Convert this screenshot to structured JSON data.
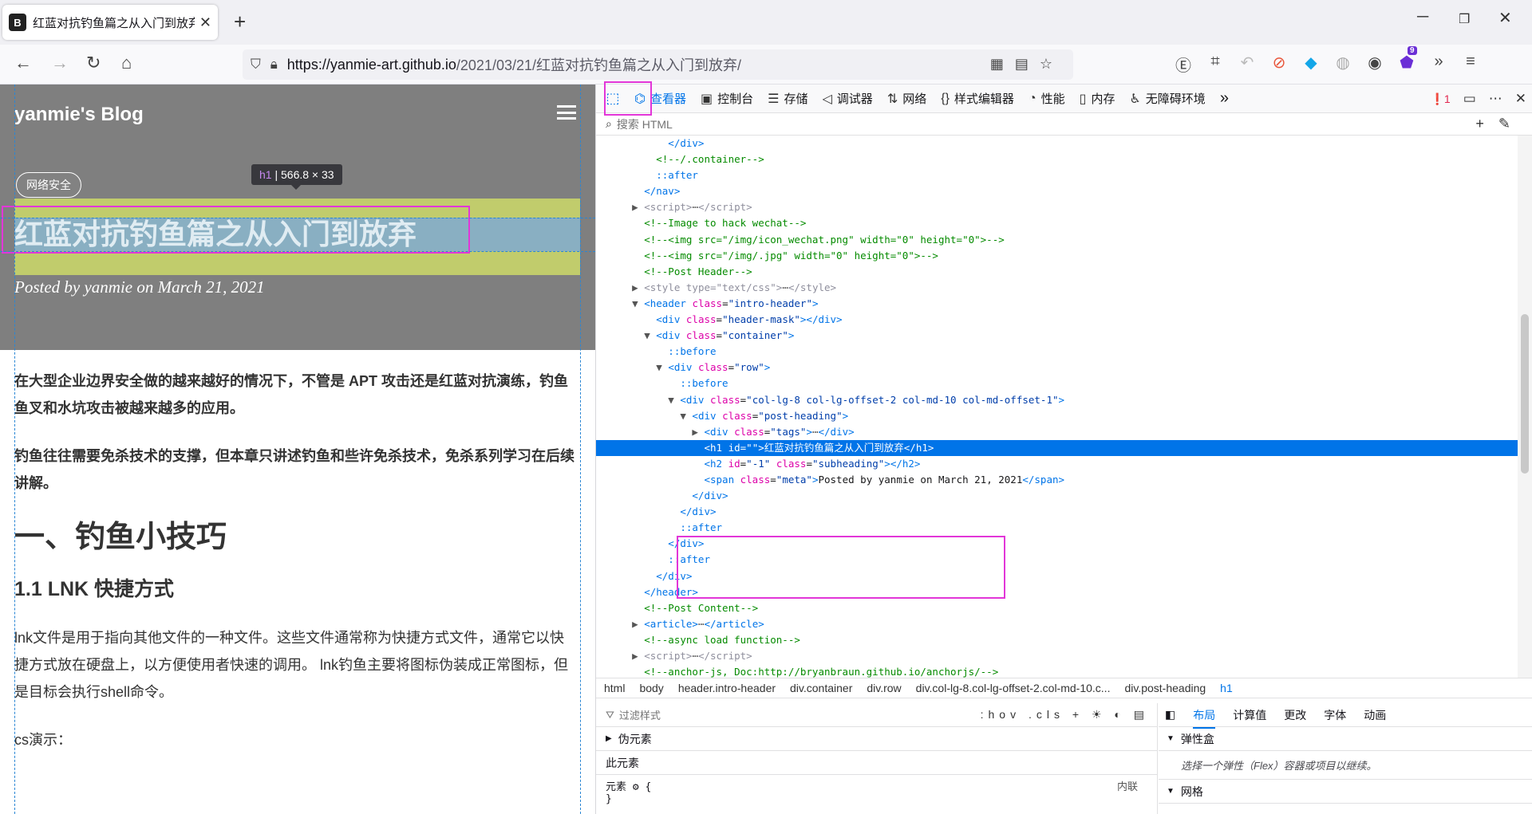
{
  "browser": {
    "tab_title": "红蓝对抗钓鱼篇之从入门到放弃",
    "favicon_text": "B",
    "url_host": "https://yanmie-art.github.io",
    "url_path": "/2021/03/21/红蓝对抗钓鱼篇之从入门到放弃/",
    "ext_badge": "9"
  },
  "page": {
    "brand": "yanmie's Blog",
    "tag": "网络安全",
    "title": "红蓝对抗钓鱼篇之从入门到放弃",
    "meta": "Posted by yanmie on March 21, 2021",
    "tooltip_tag": "h1",
    "tooltip_size": "566.8 × 33",
    "para1": "在大型企业边界安全做的越来越好的情况下，不管是 APT 攻击还是红蓝对抗演练，钓鱼鱼叉和水坑攻击被越来越多的应用。",
    "para2": "钓鱼往往需要免杀技术的支撑，但本章只讲述钓鱼和些许免杀技术，免杀系列学习在后续讲解。",
    "h1": "一、钓鱼小技巧",
    "h2": "1.1 LNK 快捷方式",
    "para3": "lnk文件是用于指向其他文件的一种文件。这些文件通常称为快捷方式文件，通常它以快捷方式放在硬盘上，以方便使用者快速的调用。 lnk钓鱼主要将图标伪装成正常图标，但是目标会执行shell命令。",
    "para4": "cs演示："
  },
  "devtools": {
    "tabs": [
      {
        "icon": "⌬",
        "label": "查看器"
      },
      {
        "icon": "▣",
        "label": "控制台"
      },
      {
        "icon": "☰",
        "label": "存储"
      },
      {
        "icon": "◁",
        "label": "调试器"
      },
      {
        "icon": "⇅",
        "label": "网络"
      },
      {
        "icon": "{}",
        "label": "样式编辑器"
      },
      {
        "icon": "◔",
        "label": "性能"
      },
      {
        "icon": "▯",
        "label": "内存"
      },
      {
        "icon": "♿",
        "label": "无障碍环境"
      }
    ],
    "error_count": "1",
    "search_placeholder": "搜索 HTML",
    "breadcrumbs": [
      "html",
      "body",
      "header.intro-header",
      "div.container",
      "div.row",
      "div.col-lg-8.col-lg-offset-2.col-md-10.c...",
      "div.post-heading",
      "h1"
    ],
    "rules": {
      "filter_placeholder": "过滤样式",
      "hov": ":hov",
      "cls": ".cls",
      "pseudo": "伪元素",
      "this_element": "此元素",
      "element_rule": "元素 ⚙ {",
      "element_close": "}",
      "inline": "内联"
    },
    "layout_tabs": [
      "布局",
      "计算值",
      "更改",
      "字体",
      "动画"
    ],
    "flexbox_title": "弹性盒",
    "flexbox_hint": "选择一个弹性（Flex）容器或项目以继续。",
    "grid_title": "网格"
  }
}
